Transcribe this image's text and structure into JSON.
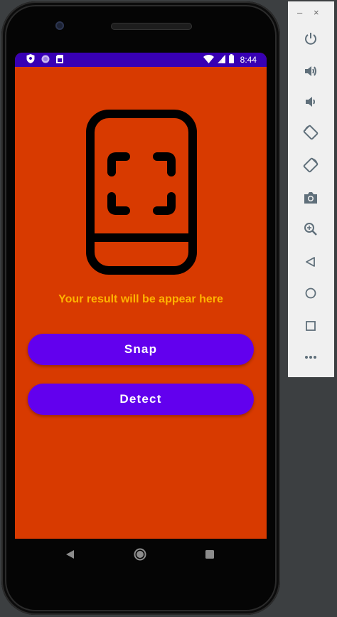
{
  "status_bar": {
    "time": "8:44",
    "left_icons": [
      "shield-icon",
      "circle-icon",
      "sim-card-icon"
    ],
    "right_icons": [
      "wifi-icon",
      "signal-icon",
      "battery-icon"
    ],
    "background": "#3800b4"
  },
  "app": {
    "background": "#d83a00",
    "illustration_icon": "phone-scan-icon",
    "result_text": "Your result will be appear here",
    "result_color": "#ffb300",
    "snap_label": "Snap",
    "detect_label": "Detect",
    "button_color": "#6200ee"
  },
  "nav_bar": {
    "back_icon": "back-triangle-icon",
    "home_icon": "home-circle-icon",
    "recents_icon": "recents-square-icon"
  },
  "emulator_panel": {
    "minimize": "–",
    "close": "×",
    "tools": [
      "power-icon",
      "volume-up-icon",
      "volume-down-icon",
      "rotate-left-icon",
      "rotate-right-icon",
      "camera-icon",
      "zoom-icon",
      "back-icon",
      "home-icon",
      "overview-icon",
      "more-icon"
    ]
  }
}
